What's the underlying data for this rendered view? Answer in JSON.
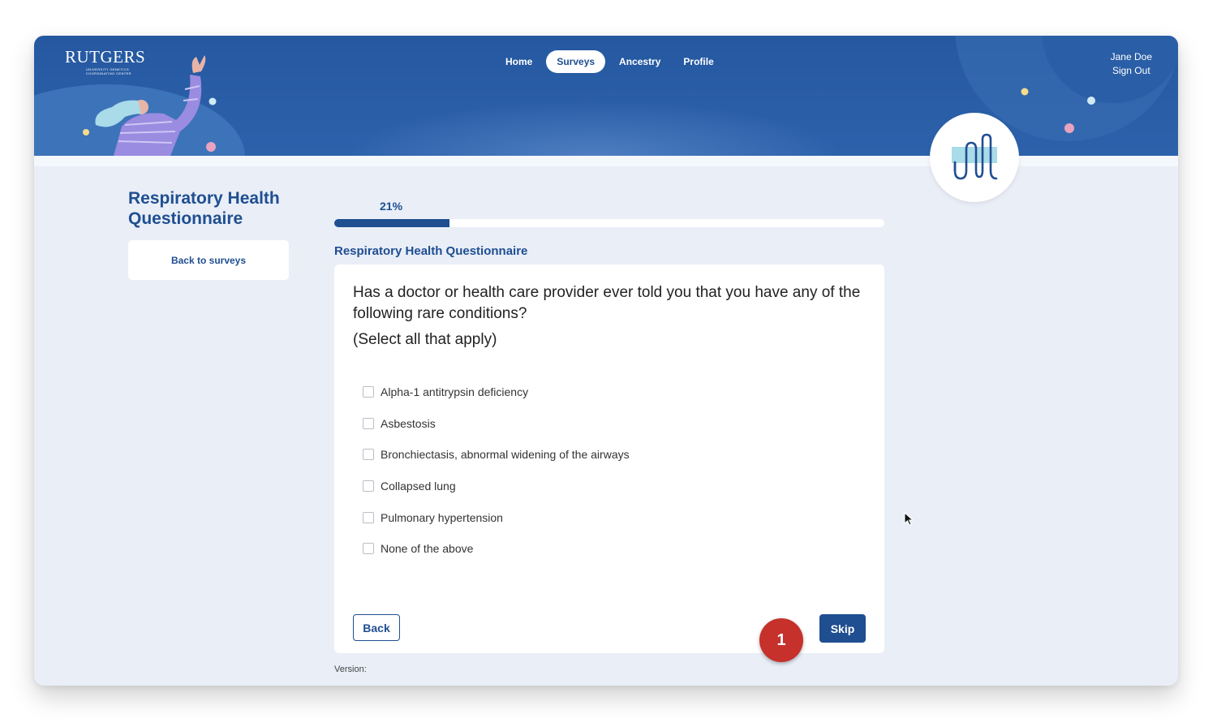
{
  "header": {
    "logo_text": "RUTGERS",
    "logo_subtext_1": "University Genetics",
    "logo_subtext_2": "Coordinating Center",
    "nav": [
      {
        "label": "Home",
        "active": false
      },
      {
        "label": "Surveys",
        "active": true
      },
      {
        "label": "Ancestry",
        "active": false
      },
      {
        "label": "Profile",
        "active": false
      }
    ],
    "user_name": "Jane Doe",
    "sign_out": "Sign Out"
  },
  "sidebar": {
    "title": "Respiratory Health Questionnaire",
    "back_label": "Back to surveys"
  },
  "progress": {
    "label": "21%",
    "value": 0.21
  },
  "survey": {
    "section_title": "Respiratory Health Questionnaire",
    "question": "Has a doctor or health care provider ever told you that you have any of the following rare conditions?",
    "instruction": "(Select all that apply)",
    "options": [
      {
        "label": "Alpha-1 antitrypsin deficiency",
        "checked": false
      },
      {
        "label": "Asbestosis",
        "checked": false
      },
      {
        "label": "Bronchiectasis, abnormal widening of the airways",
        "checked": false
      },
      {
        "label": "Collapsed lung",
        "checked": false
      },
      {
        "label": "Pulmonary hypertension",
        "checked": false
      },
      {
        "label": "None of the above",
        "checked": false
      }
    ],
    "back_button": "Back",
    "skip_button": "Skip"
  },
  "footer": {
    "version": "Version:"
  },
  "annotation": {
    "step_number": "1"
  },
  "colors": {
    "primary": "#1f4e91",
    "header_bg": "#2558a0",
    "page_bg": "#e9eef7",
    "marker_red": "#c6312b"
  }
}
